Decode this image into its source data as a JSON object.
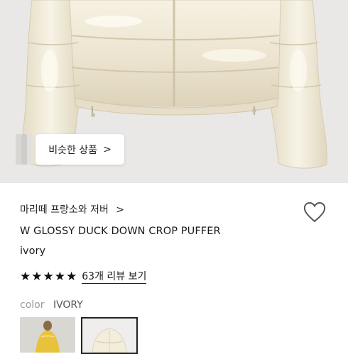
{
  "hero": {
    "similar_button_label": "비슷한 상품",
    "similar_chevron": ">"
  },
  "product": {
    "brand": "마리떼 프랑소와 저버",
    "brand_chevron": ">",
    "title": "W GLOSSY DUCK DOWN CROP PUFFER",
    "variant": "ivory",
    "rating_stars": 5,
    "review_link": "63개 리뷰 보기"
  },
  "color": {
    "label": "color",
    "value": "IVORY"
  },
  "icons": {
    "heart": "heart-outline-icon",
    "star": "star-filled-icon",
    "chevron": "chevron-right-icon"
  },
  "colors": {
    "hero_bg": "#e9e8e6",
    "jacket": "#f0ead8",
    "text": "#1a1a1a",
    "muted": "#9a9a9a"
  }
}
